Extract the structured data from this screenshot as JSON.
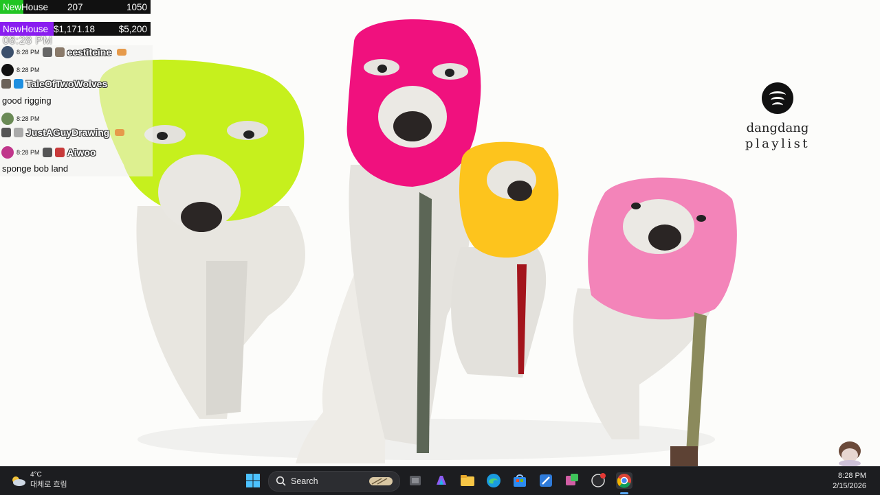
{
  "overlay": {
    "goal_bars": [
      {
        "label": "NewHouse",
        "current": "207",
        "target": "1050"
      },
      {
        "label": "NewHouse",
        "current": "$1,171.18",
        "target": "$5,200"
      }
    ],
    "clock": "08:28 PM"
  },
  "chat": [
    {
      "time": "8:28 PM",
      "user": "eestiteine",
      "message": ""
    },
    {
      "time": "8:28 PM",
      "user": "TaleOfTwoWolves",
      "message": "good rigging"
    },
    {
      "time": "8:28 PM",
      "user": "JustAGuyDrawing",
      "message": ""
    },
    {
      "time": "8:28 PM",
      "user": "Aiwoo",
      "message": "sponge bob land"
    }
  ],
  "spotify": {
    "title": "dangdang",
    "subtitle": "playlist"
  },
  "taskbar": {
    "weather_temp": "4°C",
    "weather_desc": "대체로 흐림",
    "search_placeholder": "Search",
    "time": "8:28 PM",
    "date": "2/15/2026"
  },
  "colors": {
    "goal1": "#22c523",
    "goal2": "#8a1df0",
    "taskbar": "#1c1d20"
  }
}
